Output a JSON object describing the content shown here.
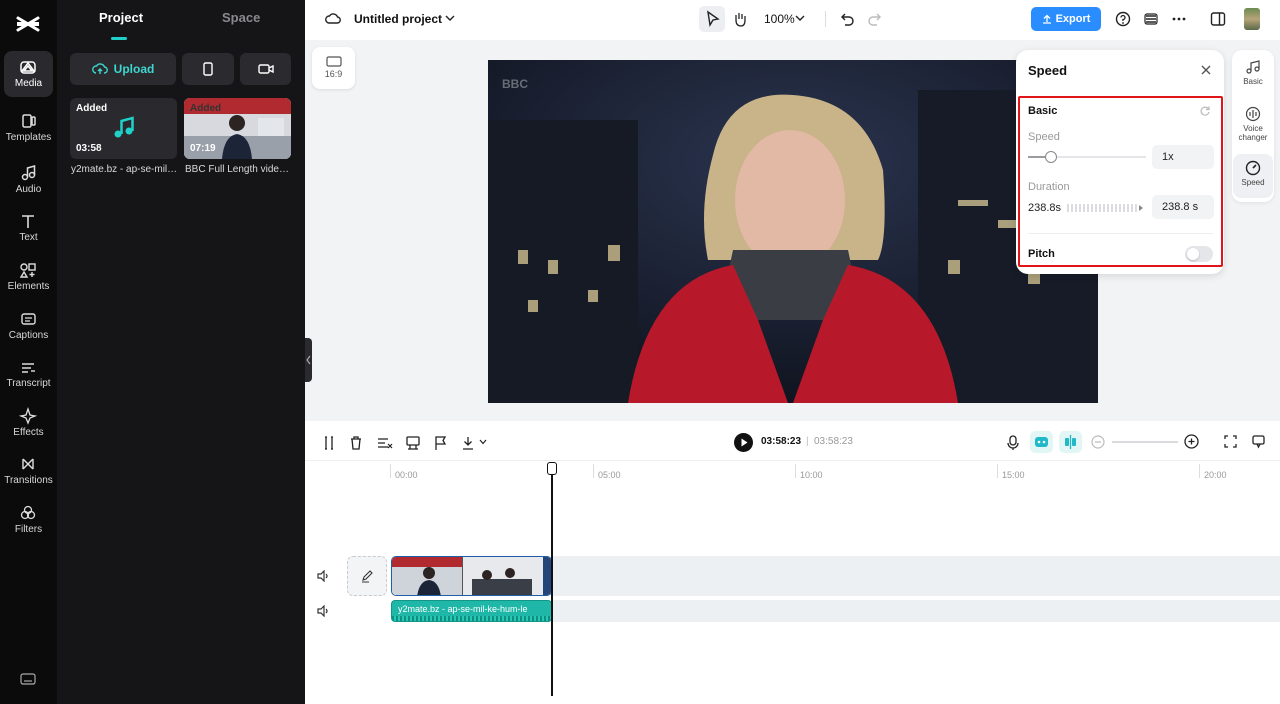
{
  "rail": {
    "items": [
      {
        "label": "Media"
      },
      {
        "label": "Templates"
      },
      {
        "label": "Audio"
      },
      {
        "label": "Text"
      },
      {
        "label": "Elements"
      },
      {
        "label": "Captions"
      },
      {
        "label": "Transcript"
      },
      {
        "label": "Effects"
      },
      {
        "label": "Transitions"
      },
      {
        "label": "Filters"
      }
    ]
  },
  "panel": {
    "tabs": [
      {
        "label": "Project"
      },
      {
        "label": "Space"
      }
    ],
    "upload_label": "Upload",
    "media": [
      {
        "tag": "Added",
        "duration": "03:58",
        "caption": "y2mate.bz - ap-se-mil-ke-hum-le..."
      },
      {
        "tag": "Added",
        "duration": "07:19",
        "caption": "BBC Full Length video..."
      }
    ]
  },
  "topbar": {
    "project_title": "Untitled project",
    "zoom": "100%",
    "export_label": "Export"
  },
  "canvas": {
    "ratio_label": "16:9",
    "video_watermark": "BBC"
  },
  "speed_panel": {
    "title": "Speed",
    "section": "Basic",
    "speed_label": "Speed",
    "speed_value": "1x",
    "duration_label": "Duration",
    "duration_left": "238.8s",
    "duration_value": "238.8 s",
    "pitch_label": "Pitch",
    "pitch_on": false
  },
  "right_rail": {
    "items": [
      {
        "label": "Basic"
      },
      {
        "label": "Voice changer"
      },
      {
        "label": "Speed"
      }
    ]
  },
  "timeline": {
    "current_time": "03:58:23",
    "total_time": "03:58:23",
    "ruler": [
      "00:00",
      "05:00",
      "10:00",
      "15:00",
      "20:00"
    ],
    "audio_clip_label": "y2mate.bz - ap-se-mil-ke-hum-le"
  },
  "colors": {
    "accent": "#1fd1c9",
    "export": "#2a8dff",
    "highlight": "#e0151a"
  }
}
